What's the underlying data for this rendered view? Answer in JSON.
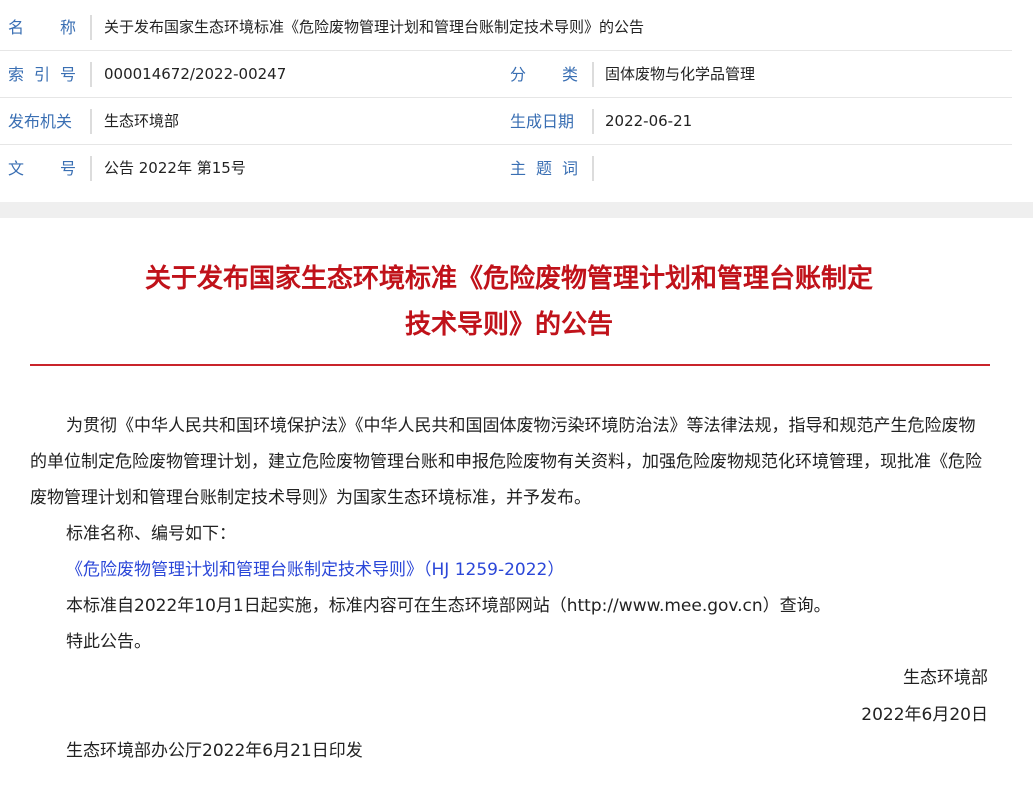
{
  "meta": {
    "name_label": "名称",
    "name_value": "关于发布国家生态环境标准《危险废物管理计划和管理台账制定技术导则》的公告",
    "index_label": "索引号",
    "index_value": "000014672/2022-00247",
    "category_label": "分类",
    "category_value": "固体废物与化学品管理",
    "issuer_label": "发布机关",
    "issuer_value": "生态环境部",
    "date_label": "生成日期",
    "date_value": "2022-06-21",
    "docno_label": "文号",
    "docno_value": "公告 2022年 第15号",
    "subject_label": "主题词",
    "subject_value": ""
  },
  "article": {
    "title_line1": "关于发布国家生态环境标准《危险废物管理计划和管理台账制定",
    "title_line2": "技术导则》的公告",
    "para1": "为贯彻《中华人民共和国环境保护法》《中华人民共和国固体废物污染环境防治法》等法律法规，指导和规范产生危险废物的单位制定危险废物管理计划，建立危险废物管理台账和申报危险废物有关资料，加强危险废物规范化环境管理，现批准《危险废物管理计划和管理台账制定技术导则》为国家生态环境标准，并予发布。",
    "list_intro": "标准名称、编号如下：",
    "standard_link": "《危险废物管理计划和管理台账制定技术导则》（HJ 1259-2022）",
    "effective": "本标准自2022年10月1日起实施，标准内容可在生态环境部网站（http://www.mee.gov.cn）查询。",
    "notice": "特此公告。",
    "signer": "生态环境部",
    "sign_date": "2022年6月20日",
    "print_note": "生态环境部办公厅2022年6月21日印发"
  },
  "colors": {
    "label_blue": "#3a6fb3",
    "title_red": "#c0121a",
    "link_blue": "#2b47d8"
  }
}
